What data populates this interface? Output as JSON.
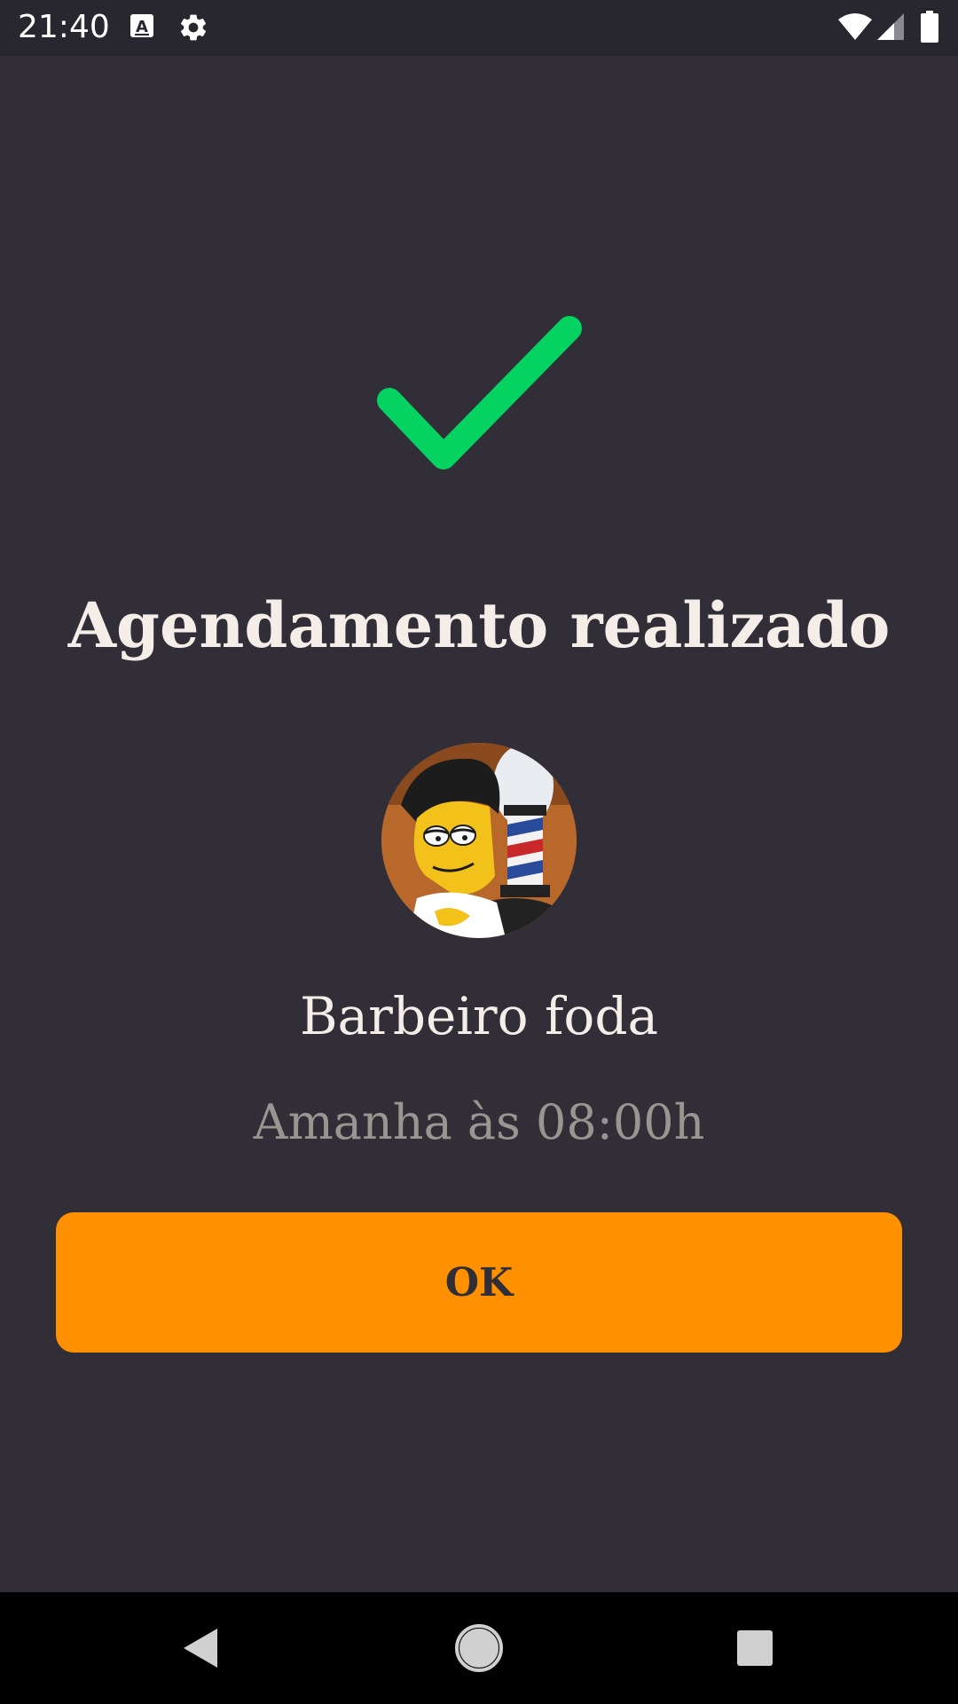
{
  "status_bar": {
    "time": "21:40",
    "icons": [
      "keyboard-a-icon",
      "settings-gear-icon",
      "wifi-icon",
      "cell-signal-icon",
      "battery-icon"
    ]
  },
  "success": {
    "icon": "checkmark-icon",
    "icon_color": "#04d361",
    "title": "Agendamento realizado"
  },
  "provider": {
    "avatar": "provider-avatar-image",
    "name": "Barbeiro foda"
  },
  "appointment": {
    "date_text": "Amanha às 08:00h"
  },
  "actions": {
    "ok_label": "OK",
    "ok_color": "#ff9000"
  },
  "nav_bar": {
    "icons": [
      "back-icon",
      "home-icon",
      "recents-icon"
    ]
  },
  "colors": {
    "background": "#312e38",
    "title_text": "#f4ede8",
    "secondary_text": "#999591"
  }
}
